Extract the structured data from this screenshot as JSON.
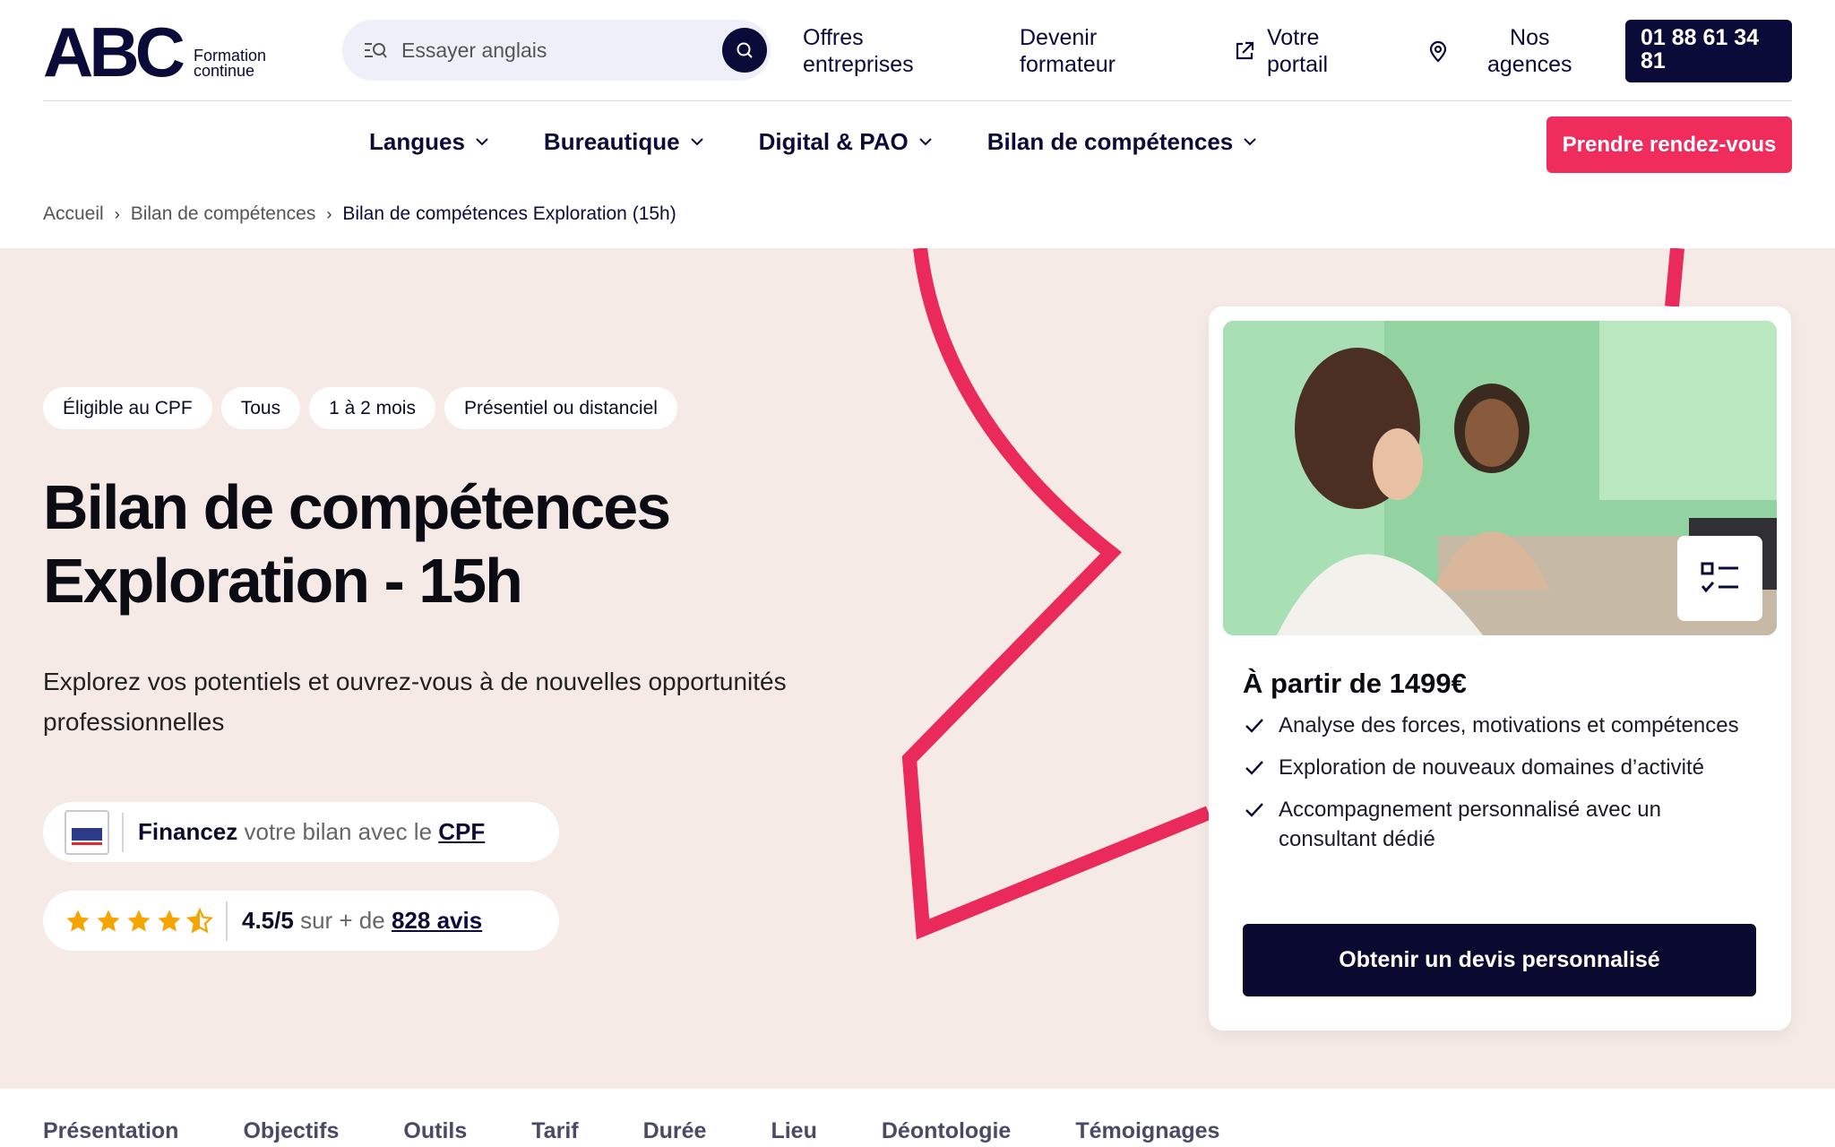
{
  "header": {
    "logo_text": "ABC",
    "logo_sub_line1": "Formation",
    "logo_sub_line2": "continue",
    "search_placeholder": "Essayer anglais",
    "links": {
      "offres": [
        "Offres",
        "entreprises"
      ],
      "devenir": [
        "Devenir",
        "formateur"
      ],
      "portail": [
        "Votre",
        "portail"
      ],
      "agences": [
        "Nos",
        "agences"
      ]
    },
    "phone": "01 88 61 34 81"
  },
  "nav": {
    "items": [
      "Langues",
      "Bureautique",
      "Digital & PAO",
      "Bilan de compétences"
    ],
    "cta": "Prendre rendez-vous"
  },
  "breadcrumb": [
    "Accueil",
    "Bilan de compétences",
    "Bilan de compétences Exploration (15h)"
  ],
  "hero": {
    "tags": [
      "Éligible au CPF",
      "Tous",
      "1 à 2 mois",
      "Présentiel ou distanciel"
    ],
    "title": "Bilan de compétences Exploration - 15h",
    "subtitle": "Explorez vos potentiels et ouvrez-vous à de nouvelles opportunités professionnelles",
    "cpf": {
      "strong": "Financez",
      "text": "votre bilan avec le",
      "link": "CPF"
    },
    "rating": {
      "score": "4.5/5",
      "text": "sur + de",
      "link": "828 avis",
      "value": 4.5,
      "max": 5
    }
  },
  "card": {
    "price": "À partir de 1499€",
    "benefits": [
      "Analyse des forces, motivations et compétences",
      "Exploration de nouveaux domaines d’activité",
      "Accompagnement personnalisé avec un consultant dédié"
    ],
    "cta": "Obtenir un devis personnalisé"
  },
  "tabs": [
    "Présentation",
    "Objectifs",
    "Outils",
    "Tarif",
    "Durée",
    "Lieu",
    "Déontologie",
    "Témoignages"
  ],
  "colors": {
    "navy": "#0b0b3a",
    "pink": "#ef2c5c",
    "hero_bg": "#f6eae6"
  }
}
